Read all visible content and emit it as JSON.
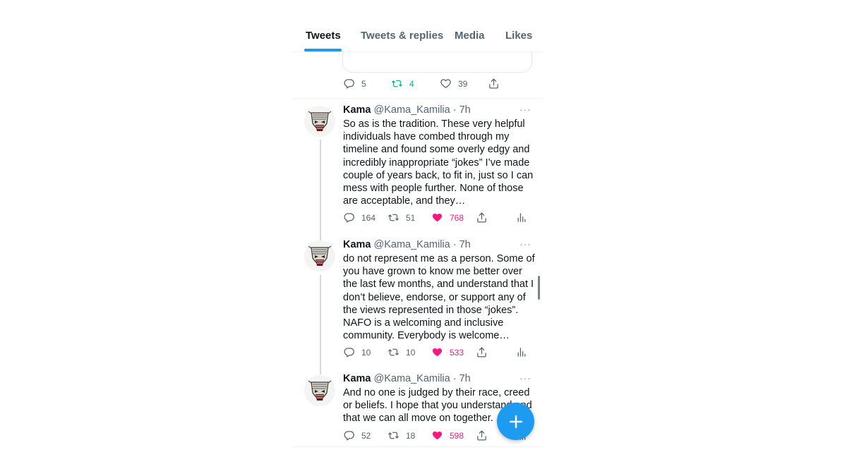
{
  "tabs": [
    {
      "label": "Tweets",
      "active": true
    },
    {
      "label": "Tweets & replies",
      "active": false
    },
    {
      "label": "Media",
      "active": false
    },
    {
      "label": "Likes",
      "active": false
    }
  ],
  "previous_tweet": {
    "replies": "5",
    "retweets": "4",
    "likes": "39"
  },
  "tweets": [
    {
      "name": "Kama",
      "handle": "@Kama_Kamilia · 7h",
      "text": "So as is the tradition. These very helpful individuals have combed through my timeline and found some overly edgy and incredibly inappropriate “jokes” I’ve made couple of years back, to fit in, just so I can mess with people further. None of those are acceptable, and they…",
      "replies": "164",
      "retweets": "51",
      "likes": "768"
    },
    {
      "name": "Kama",
      "handle": "@Kama_Kamilia · 7h",
      "text": "do not represent me as a person. Some of you have grown to know me better over the last few months, and understand that I don’t believe, endorse, or support any of the views represented in those “jokes”. NAFO is a welcoming and inclusive community. Everybody is welcome…",
      "replies": "10",
      "retweets": "10",
      "likes": "533"
    },
    {
      "name": "Kama",
      "handle": "@Kama_Kamilia · 7h",
      "text": "And no one is judged by their race, creed or beliefs. I hope that you understand and that we can all move on together.",
      "replies": "52",
      "retweets": "18",
      "likes": "598"
    }
  ],
  "icons": {
    "reply": "reply-icon",
    "retweet": "retweet-icon",
    "like": "heart-icon",
    "share": "share-icon",
    "analytics": "analytics-icon",
    "more": "more-icon",
    "compose": "compose-plus-icon"
  },
  "colors": {
    "accent": "#1d9bf0",
    "retweet_active": "#00ba7c",
    "like_active": "#f91880",
    "muted": "#536471"
  }
}
